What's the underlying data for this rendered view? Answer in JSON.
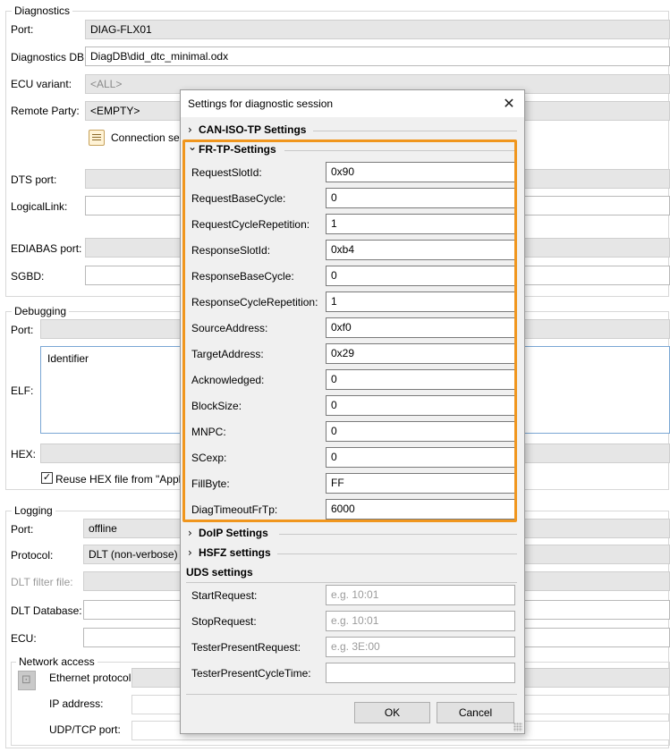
{
  "diagnostics": {
    "legend": "Diagnostics",
    "port_label": "Port:",
    "port_value": "DIAG-FLX01",
    "db_label": "Diagnostics DB:",
    "db_value": "DiagDB\\did_dtc_minimal.odx",
    "ecu_variant_label": "ECU variant:",
    "ecu_variant_value": "<ALL>",
    "remote_party_label": "Remote Party:",
    "remote_party_value": "<EMPTY>",
    "connection_settings_label": "Connection setti",
    "dts_port_label": "DTS port:",
    "logical_link_label": "LogicalLink:",
    "edias_port_label": "EDIABAS port:",
    "sgbd_label": "SGBD:"
  },
  "debugging": {
    "legend": "Debugging",
    "port_label": "Port:",
    "elf_label": "ELF:",
    "elf_header": "Identifier",
    "hex_label": "HEX:",
    "reuse_hex_label": "Reuse HEX file from \"Applicat",
    "reuse_hex_checked": true
  },
  "logging": {
    "legend": "Logging",
    "port_label": "Port:",
    "port_value": "offline",
    "protocol_label": "Protocol:",
    "protocol_value": "DLT (non-verbose)",
    "dlt_filter_label": "DLT filter file:",
    "dlt_db_label": "DLT Database:",
    "ecu_label": "ECU:"
  },
  "network": {
    "legend": "Network access",
    "ethernet_label": "Ethernet protocol:",
    "ip_label": "IP address:",
    "udp_label": "UDP/TCP port:"
  },
  "dialog": {
    "title": "Settings for diagnostic session",
    "close_glyph": "✕",
    "sections": {
      "can": "CAN-ISO-TP Settings",
      "fr": "FR-TP-Settings",
      "doip": "DoIP Settings",
      "hsfz": "HSFZ settings",
      "uds": "UDS settings"
    },
    "chevron_collapsed": "›",
    "chevron_expanded": "⌄",
    "fr_fields": [
      {
        "label": "RequestSlotId:",
        "value": "0x90"
      },
      {
        "label": "RequestBaseCycle:",
        "value": "0"
      },
      {
        "label": "RequestCycleRepetition:",
        "value": "1"
      },
      {
        "label": "ResponseSlotId:",
        "value": "0xb4"
      },
      {
        "label": "ResponseBaseCycle:",
        "value": "0"
      },
      {
        "label": "ResponseCycleRepetition:",
        "value": "1"
      },
      {
        "label": "SourceAddress:",
        "value": "0xf0"
      },
      {
        "label": "TargetAddress:",
        "value": "0x29"
      },
      {
        "label": "Acknowledged:",
        "value": "0"
      },
      {
        "label": "BlockSize:",
        "value": "0"
      },
      {
        "label": "MNPC:",
        "value": "0"
      },
      {
        "label": "SCexp:",
        "value": "0"
      },
      {
        "label": "FillByte:",
        "value": "FF"
      },
      {
        "label": "DiagTimeoutFrTp:",
        "value": "6000"
      }
    ],
    "uds_fields": [
      {
        "label": "StartRequest:",
        "placeholder": "e.g. 10:01"
      },
      {
        "label": "StopRequest:",
        "placeholder": "e.g. 10:01"
      },
      {
        "label": "TesterPresentRequest:",
        "placeholder": "e.g. 3E:00"
      },
      {
        "label": "TesterPresentCycleTime:",
        "placeholder": ""
      }
    ],
    "ok_label": "OK",
    "cancel_label": "Cancel"
  },
  "colors": {
    "highlight": "#f0961e",
    "dialog_bg": "#f0f0f0"
  }
}
